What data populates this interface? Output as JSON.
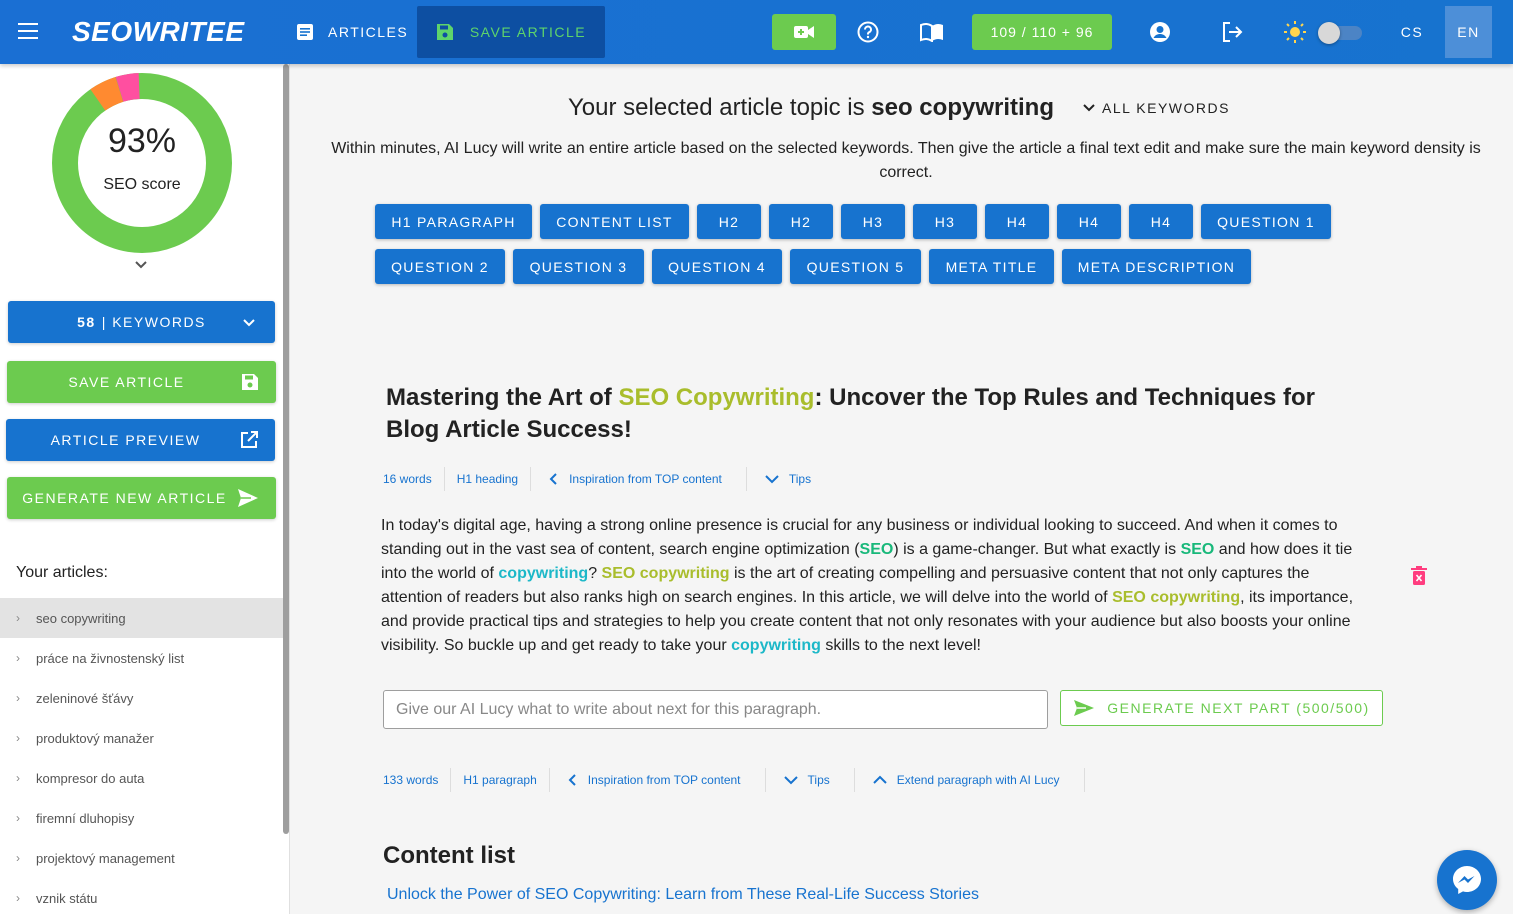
{
  "header": {
    "logo": "SEOWRITEE",
    "articles_label": "ARTICLES",
    "save_article_label": "SAVE ARTICLE",
    "credits": "109 / 110 + 96",
    "lang_cs": "CS",
    "lang_en": "EN"
  },
  "sidebar": {
    "score_value": "93%",
    "score_label": "SEO score",
    "score_segments": {
      "green": 0.86,
      "orange": 0.05,
      "pink": 0.04
    },
    "keywords_count": "58",
    "keywords_label": "| KEYWORDS",
    "save_label": "SAVE ARTICLE",
    "preview_label": "ARTICLE PREVIEW",
    "generate_label": "GENERATE NEW ARTICLE",
    "your_articles": "Your articles:",
    "articles": [
      {
        "label": "seo copywriting"
      },
      {
        "label": "práce na živnostenský list"
      },
      {
        "label": "zeleninové šťávy"
      },
      {
        "label": "produktový manažer"
      },
      {
        "label": "kompresor do auta"
      },
      {
        "label": "firemní dluhopisy"
      },
      {
        "label": "projektový management"
      },
      {
        "label": "vznik státu"
      }
    ]
  },
  "main": {
    "topic_prefix": "Your selected article topic is ",
    "topic": "seo copywriting",
    "all_keywords": "ALL KEYWORDS",
    "intro": "Within minutes, AI Lucy will write an entire article based on the selected keywords. Then give the article a final text edit and make sure the main keyword density is correct.",
    "section_buttons": [
      "H1 PARAGRAPH",
      "CONTENT LIST",
      "H2",
      "H2",
      "H3",
      "H3",
      "H4",
      "H4",
      "H4",
      "QUESTION 1",
      "QUESTION 2",
      "QUESTION 3",
      "QUESTION 4",
      "QUESTION 5",
      "META TITLE",
      "META DESCRIPTION"
    ],
    "h1_part1": "Mastering the Art of ",
    "h1_keyword": "SEO Copywriting",
    "h1_part2": ": Uncover the Top Rules and Techniques for Blog Article Success!",
    "h1_meta": {
      "words": "16 words",
      "type": "H1 heading",
      "inspiration": "Inspiration from TOP content",
      "tips": "Tips"
    },
    "paragraph": {
      "t1": "In today's digital age, having a strong online presence is crucial for any business or individual looking to succeed. And when it comes to standing out in the vast sea of content, search engine optimization (",
      "k1": "SEO",
      "t2": ") is a game-changer. But what exactly is ",
      "k2": "SEO",
      "t3": " and how does it tie into the world of ",
      "k3": "copywriting",
      "t4": "? ",
      "k4": "SEO copywriting",
      "t5": " is the art of creating compelling and persuasive content that not only captures the attention of readers but also ranks high on search engines. In this article, we will delve into the world of ",
      "k5": "SEO copywriting",
      "t6": ", its importance, and provide practical tips and strategies to help you create content that not only resonates with your audience but also boosts your online visibility. So buckle up and get ready to take your ",
      "k6": "copywriting",
      "t7": " skills to the next level!"
    },
    "ai_placeholder": "Give our AI Lucy what to write about next for this paragraph.",
    "generate_next": "GENERATE NEXT PART (500/500)",
    "para_meta": {
      "words": "133 words",
      "type": "H1 paragraph",
      "inspiration": "Inspiration from TOP content",
      "tips": "Tips",
      "extend": "Extend paragraph with AI Lucy"
    },
    "content_list_heading": "Content list",
    "content_list_item": "Unlock the Power of SEO Copywriting: Learn from These Real-Life Success Stories"
  },
  "colors": {
    "primary": "#1773cf",
    "green": "#6ccb4f",
    "keyword_olive": "#a9bd2c",
    "keyword_green": "#18b87a",
    "keyword_teal": "#1cb8c8"
  }
}
